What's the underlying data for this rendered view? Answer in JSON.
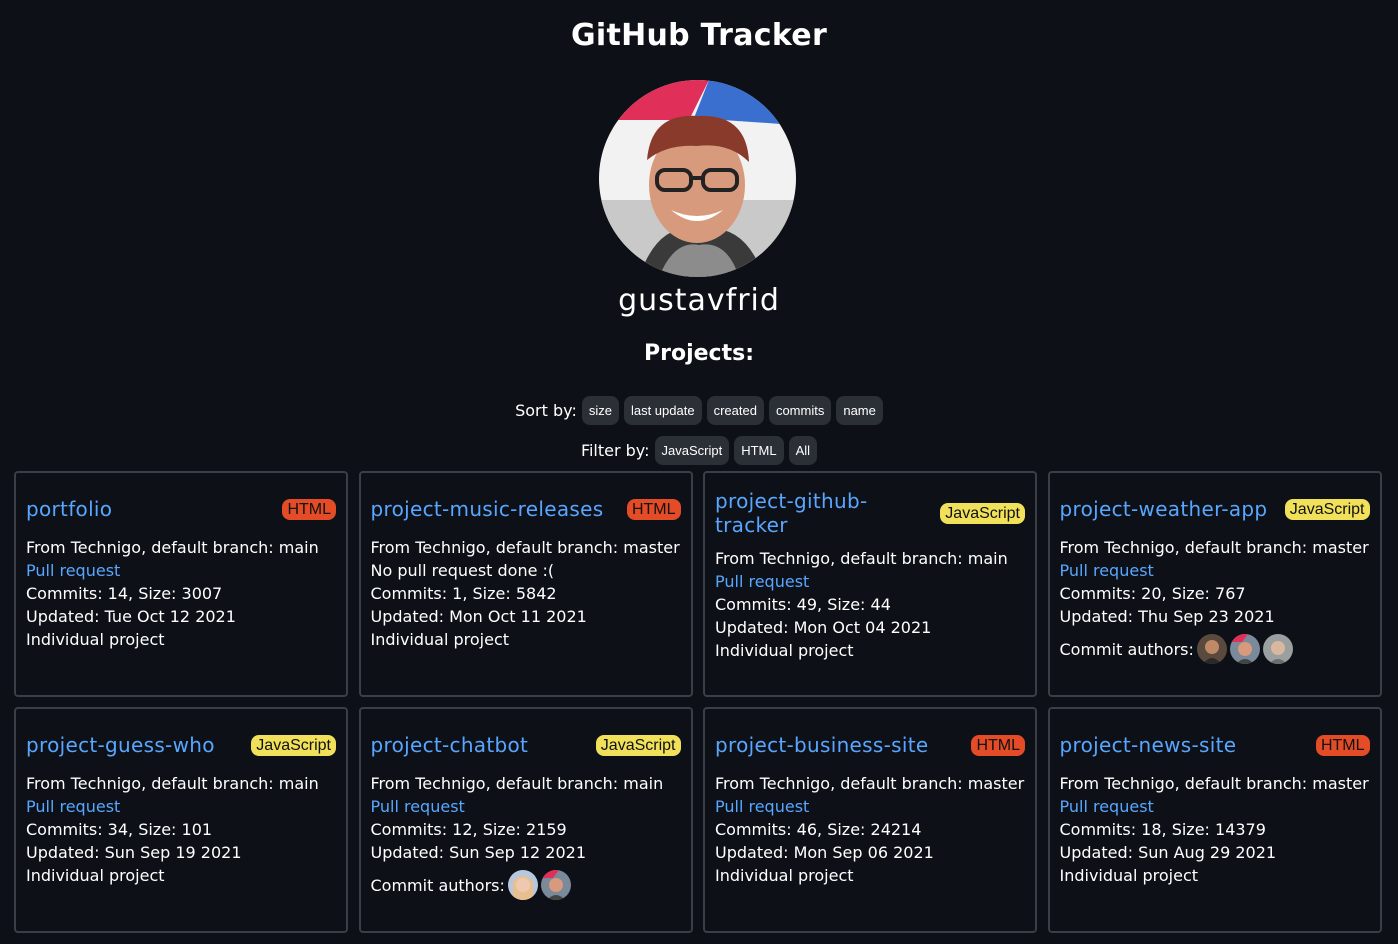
{
  "header": {
    "title": "GitHub Tracker"
  },
  "profile": {
    "username": "gustavfrid"
  },
  "projects_heading": "Projects:",
  "sort": {
    "label": "Sort by:",
    "options": [
      "size",
      "last update",
      "created",
      "commits",
      "name"
    ]
  },
  "filter": {
    "label": "Filter by:",
    "options": [
      "JavaScript",
      "HTML",
      "All"
    ]
  },
  "colors": {
    "background": "#0d1117",
    "link": "#58a6ff",
    "html_badge": "#e34c26",
    "js_badge": "#f1e05a"
  },
  "repos": [
    {
      "name": "portfolio",
      "language": "HTML",
      "branch": "From Technigo, default branch: main",
      "pr": "Pull request",
      "stats": "Commits: 14, Size: 3007",
      "updated": "Updated: Tue Oct 12 2021",
      "type": "Individual project"
    },
    {
      "name": "project-music-releases",
      "language": "HTML",
      "branch": "From Technigo, default branch: master",
      "pr": "No pull request done :(",
      "stats": "Commits: 1, Size: 5842",
      "updated": "Updated: Mon Oct 11 2021",
      "type": "Individual project"
    },
    {
      "name": "project-github-tracker",
      "language": "JavaScript",
      "branch": "From Technigo, default branch: main",
      "pr": "Pull request",
      "stats": "Commits: 49, Size: 44",
      "updated": "Updated: Mon Oct 04 2021",
      "type": "Individual project"
    },
    {
      "name": "project-weather-app",
      "language": "JavaScript",
      "branch": "From Technigo, default branch: master",
      "pr": "Pull request",
      "stats": "Commits: 20, Size: 767",
      "updated": "Updated: Thu Sep 23 2021",
      "authors_label": "Commit authors:"
    },
    {
      "name": "project-guess-who",
      "language": "JavaScript",
      "branch": "From Technigo, default branch: main",
      "pr": "Pull request",
      "stats": "Commits: 34, Size: 101",
      "updated": "Updated: Sun Sep 19 2021",
      "type": "Individual project"
    },
    {
      "name": "project-chatbot",
      "language": "JavaScript",
      "branch": "From Technigo, default branch: main",
      "pr": "Pull request",
      "stats": "Commits: 12, Size: 2159",
      "updated": "Updated: Sun Sep 12 2021",
      "authors_label": "Commit authors:"
    },
    {
      "name": "project-business-site",
      "language": "HTML",
      "branch": "From Technigo, default branch: master",
      "pr": "Pull request",
      "stats": "Commits: 46, Size: 24214",
      "updated": "Updated: Mon Sep 06 2021",
      "type": "Individual project"
    },
    {
      "name": "project-news-site",
      "language": "HTML",
      "branch": "From Technigo, default branch: master",
      "pr": "Pull request",
      "stats": "Commits: 18, Size: 14379",
      "updated": "Updated: Sun Aug 29 2021",
      "type": "Individual project"
    }
  ]
}
